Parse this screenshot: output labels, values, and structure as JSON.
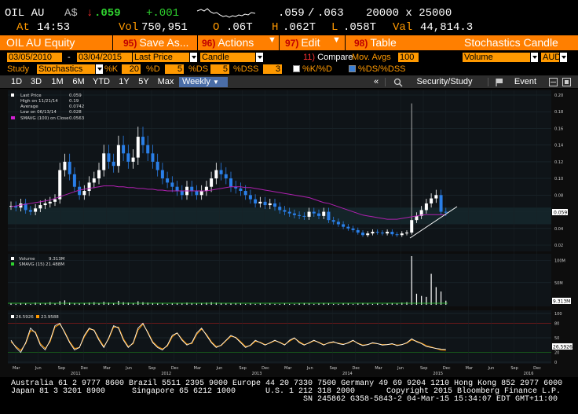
{
  "quote": {
    "ticker": "OIL AU",
    "currency": "A$",
    "arrow": "↓",
    "last": ".059",
    "change": "+.001",
    "bid": ".059",
    "slash": "/",
    "ask": ".063",
    "size": "20000 x 25000",
    "at_label": "At",
    "time": "14:53",
    "vol_label": "Vol",
    "vol": "750,951",
    "open_label": "O",
    "open": ".06T",
    "high_label": "H",
    "high": ".062T",
    "low_label": "L",
    "low": ".058T",
    "val_label": "Val",
    "val": "44,814.3"
  },
  "function_bar": {
    "security": "OIL AU Equity",
    "save": {
      "num": "95)",
      "label": "Save As..."
    },
    "actions": {
      "num": "96)",
      "label": "Actions"
    },
    "edit": {
      "num": "97)",
      "label": "Edit"
    },
    "table": {
      "num": "98)",
      "label": "Table"
    },
    "title": "Stochastics Candle"
  },
  "row2": {
    "start_date": "03/05/2010",
    "dash": "-",
    "end_date": "03/04/2015",
    "price_field": "Last Price",
    "chart_type": "Candle",
    "compare_num": "11)",
    "compare": "Compare",
    "mov_avgs": "Mov. Avgs",
    "period": "100",
    "lower": "Volume",
    "currency": "AUD"
  },
  "row3": {
    "study_label": "Study",
    "study": "Stochastics",
    "k_label": "%K",
    "k": "20",
    "d_label": "%D",
    "d": "5",
    "ds_label": "%DS",
    "ds": "5",
    "dss_label": "%DSS",
    "dss": "3",
    "kd_label": "%K/%D",
    "dsdss_label": "%DS/%DSS"
  },
  "tabs": {
    "items": [
      "1D",
      "3D",
      "1M",
      "6M",
      "YTD",
      "1Y",
      "5Y",
      "Max",
      "Weekly"
    ],
    "active": "Weekly",
    "security_study": "Security/Study",
    "event": "Event"
  },
  "legend_main": {
    "last_price": "Last Price",
    "last_price_val": "0.059",
    "high_on": "High on 11/21/14",
    "high_val": "0.19",
    "average": "Average",
    "average_val": "0.0742",
    "low_on": "Low on 06/13/14",
    "low_val": "0.028",
    "smavg": "SMAVG (100) on Close",
    "smavg_val": "0.0563"
  },
  "legend_vol": {
    "volume": "Volume",
    "volume_val": "9.313M",
    "smavg": "SMAVG (15)",
    "smavg_val": "21.488M"
  },
  "legend_stoch": {
    "a": "26.5926",
    "b": "23.9588"
  },
  "price_tag": "0.059",
  "vol_tag": "9.313M",
  "stoch_tag": "26.5926",
  "x_labels": {
    "months": [
      "Mar",
      "Jun",
      "Sep",
      "Dec",
      "Mar",
      "Jun",
      "Sep",
      "Dec",
      "Mar",
      "Jun",
      "Sep",
      "Dec",
      "Mar",
      "Jun",
      "Sep",
      "Dec",
      "Mar",
      "Jun",
      "Sep",
      "Dec",
      "Mar",
      "Jun",
      "Sep",
      "Dec"
    ],
    "years": [
      "2011",
      "2012",
      "2013",
      "2014",
      "2015",
      "2016"
    ]
  },
  "footer": {
    "line1": "Australia 61 2 9777 8600 Brazil 5511 2395 9000 Europe 44 20 7330 7500 Germany 49 69 9204 1210 Hong Kong 852 2977 6000",
    "line2a": "Japan 81 3 3201 8900",
    "line2b": "Singapore 65 6212 1000",
    "line2c": "U.S. 1 212 318 2000",
    "line2d": "Copyright 2015 Bloomberg Finance L.P.",
    "line3": "SN 245862 G358-5843-2 04-Mar-15 15:34:07 EDT  GMT+11:00"
  },
  "chart_data": {
    "type": "candlestick",
    "title": "",
    "y_ticks_price": [
      "0.20",
      "0.18",
      "0.16",
      "0.14",
      "0.12",
      "0.10",
      "0.08",
      "0.06",
      "0.04",
      "0.02"
    ],
    "y_ticks_volume": [
      "100M",
      "50M"
    ],
    "y_ticks_stoch": [
      "100",
      "80",
      "50",
      "20",
      "0"
    ],
    "close": [
      0.067,
      0.065,
      0.07,
      0.062,
      0.06,
      0.064,
      0.068,
      0.07,
      0.072,
      0.075,
      0.11,
      0.12,
      0.105,
      0.09,
      0.08,
      0.085,
      0.095,
      0.1,
      0.11,
      0.13,
      0.12,
      0.115,
      0.14,
      0.13,
      0.12,
      0.125,
      0.15,
      0.14,
      0.13,
      0.12,
      0.11,
      0.1,
      0.095,
      0.09,
      0.085,
      0.08,
      0.09,
      0.085,
      0.08,
      0.085,
      0.09,
      0.1,
      0.11,
      0.105,
      0.1,
      0.09,
      0.088,
      0.085,
      0.08,
      0.075,
      0.07,
      0.072,
      0.068,
      0.07,
      0.066,
      0.062,
      0.06,
      0.058,
      0.056,
      0.055,
      0.054,
      0.06,
      0.058,
      0.055,
      0.06,
      0.05,
      0.048,
      0.045,
      0.042,
      0.04,
      0.038,
      0.035,
      0.032,
      0.034,
      0.036,
      0.035,
      0.034,
      0.036,
      0.033,
      0.032,
      0.034,
      0.035,
      0.05,
      0.055,
      0.062,
      0.07,
      0.076,
      0.08,
      0.06,
      0.059
    ],
    "sma100": [
      0.066,
      0.067,
      0.068,
      0.069,
      0.07,
      0.071,
      0.072,
      0.073,
      0.074,
      0.076,
      0.078,
      0.08,
      0.082,
      0.084,
      0.086,
      0.087,
      0.088,
      0.089,
      0.09,
      0.091,
      0.091,
      0.091,
      0.09,
      0.09,
      0.089,
      0.089,
      0.088,
      0.088,
      0.087,
      0.087,
      0.086,
      0.086,
      0.085,
      0.085,
      0.085,
      0.085,
      0.085,
      0.085,
      0.085,
      0.085,
      0.085,
      0.086,
      0.087,
      0.088,
      0.089,
      0.09,
      0.09,
      0.09,
      0.089,
      0.089,
      0.088,
      0.087,
      0.086,
      0.085,
      0.084,
      0.083,
      0.082,
      0.081,
      0.08,
      0.079,
      0.078,
      0.077,
      0.075,
      0.073,
      0.071,
      0.07,
      0.068,
      0.066,
      0.064,
      0.062,
      0.06,
      0.058,
      0.056,
      0.055,
      0.054,
      0.053,
      0.052,
      0.051,
      0.051,
      0.051,
      0.052,
      0.053,
      0.054,
      0.055,
      0.056,
      0.0565,
      0.0565,
      0.0565,
      0.0564,
      0.0563
    ],
    "volume": [
      3,
      2,
      4,
      3,
      2,
      5,
      3,
      4,
      6,
      3,
      8,
      10,
      5,
      4,
      3,
      4,
      5,
      6,
      4,
      7,
      5,
      4,
      9,
      6,
      5,
      4,
      8,
      6,
      5,
      4,
      3,
      3,
      2,
      3,
      4,
      3,
      5,
      4,
      3,
      4,
      5,
      6,
      5,
      4,
      3,
      3,
      4,
      3,
      2,
      3,
      2,
      3,
      2,
      3,
      2,
      2,
      3,
      2,
      2,
      3,
      4,
      3,
      2,
      3,
      4,
      3,
      2,
      2,
      3,
      3,
      2,
      3,
      4,
      3,
      2,
      3,
      2,
      3,
      4,
      3,
      5,
      6,
      110,
      25,
      20,
      18,
      70,
      40,
      30,
      9.313
    ],
    "stoch_a": [
      45,
      30,
      20,
      40,
      70,
      60,
      35,
      25,
      45,
      75,
      80,
      60,
      40,
      25,
      30,
      55,
      70,
      65,
      45,
      30,
      50,
      75,
      70,
      45,
      30,
      40,
      70,
      80,
      60,
      40,
      30,
      25,
      35,
      55,
      60,
      45,
      35,
      40,
      60,
      70,
      55,
      40,
      30,
      35,
      45,
      55,
      50,
      40,
      30,
      35,
      45,
      40,
      35,
      40,
      45,
      40,
      35,
      45,
      50,
      40,
      35,
      40,
      45,
      40,
      35,
      40,
      42,
      38,
      36,
      40,
      45,
      38,
      34,
      36,
      40,
      38,
      35,
      36,
      38,
      34,
      36,
      40,
      48,
      42,
      38,
      32,
      30,
      28,
      27,
      26.5926
    ],
    "stoch_b": [
      42,
      32,
      24,
      38,
      65,
      62,
      38,
      28,
      42,
      72,
      78,
      62,
      42,
      28,
      30,
      52,
      68,
      66,
      48,
      32,
      48,
      72,
      72,
      48,
      32,
      38,
      66,
      78,
      62,
      42,
      32,
      27,
      33,
      52,
      60,
      47,
      37,
      38,
      57,
      68,
      57,
      42,
      32,
      34,
      44,
      53,
      51,
      42,
      32,
      34,
      43,
      41,
      36,
      39,
      44,
      41,
      36,
      43,
      49,
      42,
      36,
      39,
      44,
      41,
      36,
      39,
      41,
      39,
      37,
      39,
      44,
      39,
      35,
      36,
      39,
      38,
      36,
      36,
      37,
      35,
      36,
      39,
      46,
      43,
      39,
      34,
      31,
      28,
      25,
      23.9588
    ]
  }
}
